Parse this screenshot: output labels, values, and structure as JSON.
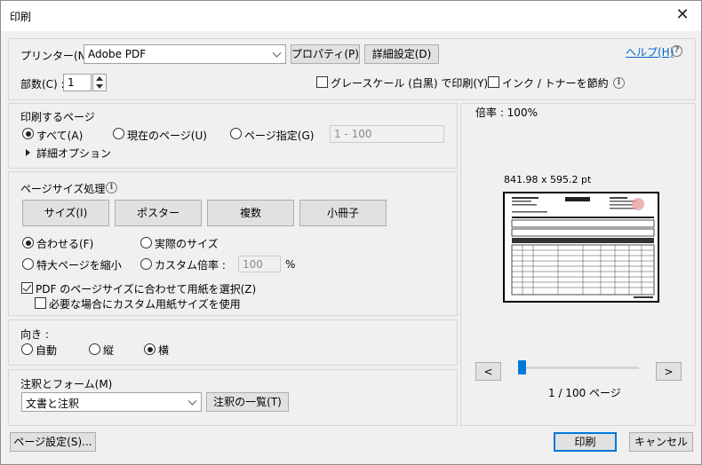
{
  "window": {
    "title": "印刷",
    "close_glyph": "✕"
  },
  "printer": {
    "label": "プリンター(N) :",
    "selected": "Adobe PDF",
    "properties_button": "プロパティ(P)",
    "advanced_button": "詳細設定(D)",
    "help_link": "ヘルプ(H)",
    "copies_label": "部数(C) :",
    "copies_value": "1",
    "grayscale_label": "グレースケール (白黒) で印刷(Y)",
    "grayscale_checked": false,
    "save_ink_label": "インク / トナーを節約",
    "save_ink_checked": false
  },
  "pages": {
    "title": "印刷するページ",
    "all_label": "すべて(A)",
    "current_label": "現在のページ(U)",
    "range_label": "ページ指定(G)",
    "range_value": "1 - 100",
    "more_options": "詳細オプション",
    "selected": "all"
  },
  "sizing": {
    "title": "ページサイズ処理",
    "tabs": [
      "サイズ(I)",
      "ポスター",
      "複数",
      "小冊子"
    ],
    "fit_label": "合わせる(F)",
    "actual_label": "実際のサイズ",
    "shrink_label": "特大ページを縮小",
    "custom_label": "カスタム倍率 :",
    "custom_value": "100",
    "percent": "%",
    "selected": "fit",
    "choose_paper_label": "PDF のページサイズに合わせて用紙を選択(Z)",
    "choose_paper_checked": true,
    "custom_paper_label": "必要な場合にカスタム用紙サイズを使用",
    "custom_paper_checked": false
  },
  "orientation": {
    "title": "向き :",
    "auto_label": "自動",
    "portrait_label": "縦",
    "landscape_label": "横",
    "selected": "landscape"
  },
  "comments": {
    "title": "注釈とフォーム(M)",
    "selected": "文書と注釈",
    "summary_button": "注釈の一覧(T)"
  },
  "preview": {
    "zoom": "倍率 : 100%",
    "page_size": "841.98 x 595.2 pt",
    "prev": "<",
    "next": ">",
    "page_indicator": "1 / 100 ページ",
    "slider_position": 0.01
  },
  "footer": {
    "page_setup": "ページ設定(S)...",
    "print": "印刷",
    "cancel": "キャンセル"
  },
  "colors": {
    "accent": "#0078d7",
    "link": "#0066cc",
    "stamp": "#e8a0a0"
  }
}
